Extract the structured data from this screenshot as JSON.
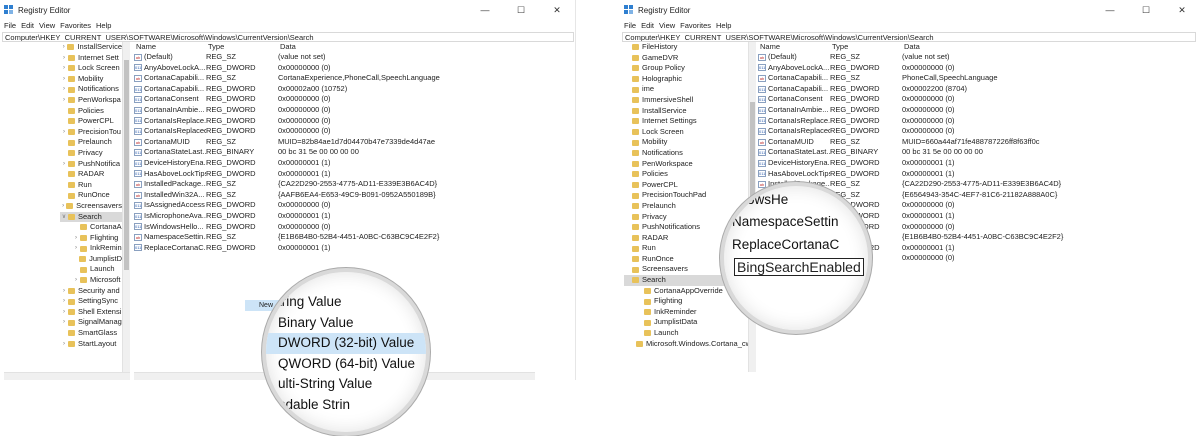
{
  "left": {
    "window_title": "Registry Editor",
    "menu": [
      "File",
      "Edit",
      "View",
      "Favorites",
      "Help"
    ],
    "address": "Computer\\HKEY_CURRENT_USER\\SOFTWARE\\Microsoft\\Windows\\CurrentVersion\\Search",
    "tree": [
      {
        "label": "InstallService",
        "chev": ">",
        "indent": 0
      },
      {
        "label": "Internet Sett",
        "chev": ">",
        "indent": 0
      },
      {
        "label": "Lock Screen",
        "chev": ">",
        "indent": 0
      },
      {
        "label": "Mobility",
        "chev": ">",
        "indent": 0
      },
      {
        "label": "Notifications",
        "chev": ">",
        "indent": 0
      },
      {
        "label": "PenWorkspa",
        "chev": ">",
        "indent": 0
      },
      {
        "label": "Policies",
        "chev": "",
        "indent": 0
      },
      {
        "label": "PowerCPL",
        "chev": "",
        "indent": 0
      },
      {
        "label": "PrecisionTou",
        "chev": ">",
        "indent": 0
      },
      {
        "label": "Prelaunch",
        "chev": "",
        "indent": 0
      },
      {
        "label": "Privacy",
        "chev": "",
        "indent": 0
      },
      {
        "label": "PushNotifica",
        "chev": ">",
        "indent": 0
      },
      {
        "label": "RADAR",
        "chev": "",
        "indent": 0
      },
      {
        "label": "Run",
        "chev": "",
        "indent": 0
      },
      {
        "label": "RunOnce",
        "chev": "",
        "indent": 0
      },
      {
        "label": "Screensavers",
        "chev": ">",
        "indent": 0
      },
      {
        "label": "Search",
        "chev": "v",
        "indent": 0,
        "selected": true
      },
      {
        "label": "CortanaA",
        "chev": "",
        "indent": 1
      },
      {
        "label": "Flighting",
        "chev": ">",
        "indent": 1
      },
      {
        "label": "InkRemin",
        "chev": ">",
        "indent": 1
      },
      {
        "label": "JumplistD",
        "chev": "",
        "indent": 1
      },
      {
        "label": "Launch",
        "chev": "",
        "indent": 1
      },
      {
        "label": "Microsoft",
        "chev": ">",
        "indent": 1
      },
      {
        "label": "Security and",
        "chev": ">",
        "indent": 0
      },
      {
        "label": "SettingSync",
        "chev": ">",
        "indent": 0
      },
      {
        "label": "Shell Extensi",
        "chev": ">",
        "indent": 0
      },
      {
        "label": "SignalManag",
        "chev": ">",
        "indent": 0
      },
      {
        "label": "SmartGlass",
        "chev": "",
        "indent": 0
      },
      {
        "label": "StartLayout",
        "chev": ">",
        "indent": 0
      }
    ],
    "headers": {
      "name": "Name",
      "type": "Type",
      "data": "Data"
    },
    "values": [
      {
        "icon": "ab",
        "name": "(Default)",
        "type": "REG_SZ",
        "data": "(value not set)"
      },
      {
        "icon": "011",
        "name": "AnyAboveLockA...",
        "type": "REG_DWORD",
        "data": "0x00000000 (0)"
      },
      {
        "icon": "ab",
        "name": "CortanaCapabili...",
        "type": "REG_SZ",
        "data": "CortanaExperience,PhoneCall,SpeechLanguage"
      },
      {
        "icon": "011",
        "name": "CortanaCapabili...",
        "type": "REG_DWORD",
        "data": "0x00002a00 (10752)"
      },
      {
        "icon": "011",
        "name": "CortanaConsent",
        "type": "REG_DWORD",
        "data": "0x00000000 (0)"
      },
      {
        "icon": "011",
        "name": "CortanaInAmbie...",
        "type": "REG_DWORD",
        "data": "0x00000000 (0)"
      },
      {
        "icon": "011",
        "name": "CortanaIsReplace...",
        "type": "REG_DWORD",
        "data": "0x00000000 (0)"
      },
      {
        "icon": "011",
        "name": "CortanaIsReplaced",
        "type": "REG_DWORD",
        "data": "0x00000000 (0)"
      },
      {
        "icon": "ab",
        "name": "CortanaMUID",
        "type": "REG_SZ",
        "data": "MUID=82b84ae1d7d04470b47e7339de4d47ae"
      },
      {
        "icon": "011",
        "name": "CortanaStateLast...",
        "type": "REG_BINARY",
        "data": "00 bc 31 5e 00 00 00 00"
      },
      {
        "icon": "011",
        "name": "DeviceHistoryEna...",
        "type": "REG_DWORD",
        "data": "0x00000001 (1)"
      },
      {
        "icon": "011",
        "name": "HasAboveLockTips",
        "type": "REG_DWORD",
        "data": "0x00000001 (1)"
      },
      {
        "icon": "ab",
        "name": "InstalledPackage...",
        "type": "REG_SZ",
        "data": "{CA22D290-2553-4775-AD11-E339E3B6AC4D}"
      },
      {
        "icon": "ab",
        "name": "InstalledWin32A...",
        "type": "REG_SZ",
        "data": "{AAFB6EA4-E653-49C9-B091-0952A550189B}"
      },
      {
        "icon": "011",
        "name": "IsAssignedAccess",
        "type": "REG_DWORD",
        "data": "0x00000000 (0)"
      },
      {
        "icon": "011",
        "name": "IsMicrophoneAva...",
        "type": "REG_DWORD",
        "data": "0x00000001 (1)"
      },
      {
        "icon": "011",
        "name": "IsWindowsHello...",
        "type": "REG_DWORD",
        "data": "0x00000000 (0)"
      },
      {
        "icon": "ab",
        "name": "NamespaceSettin...",
        "type": "REG_SZ",
        "data": "{E1B6B4B0-52B4-4451-A0BC-C63BC9C4E2F2}"
      },
      {
        "icon": "011",
        "name": "ReplaceCortanaC...",
        "type": "REG_DWORD",
        "data": "0x00000001 (1)"
      }
    ],
    "context_menu_new": "New",
    "magnifier_items": [
      "tring Value",
      "Binary Value",
      "DWORD (32-bit) Value",
      "QWORD (64-bit) Value",
      "ulti-String Value",
      "ndable Strin"
    ]
  },
  "right": {
    "window_title": "Registry Editor",
    "menu": [
      "File",
      "Edit",
      "View",
      "Favorites",
      "Help"
    ],
    "address": "Computer\\HKEY_CURRENT_USER\\SOFTWARE\\Microsoft\\Windows\\CurrentVersion\\Search",
    "tree": [
      {
        "label": "FileHistory",
        "indent": 0
      },
      {
        "label": "GameDVR",
        "indent": 0
      },
      {
        "label": "Group Policy",
        "indent": 0
      },
      {
        "label": "Holographic",
        "indent": 0
      },
      {
        "label": "ime",
        "indent": 0
      },
      {
        "label": "ImmersiveShell",
        "indent": 0
      },
      {
        "label": "InstallService",
        "indent": 0
      },
      {
        "label": "Internet Settings",
        "indent": 0
      },
      {
        "label": "Lock Screen",
        "indent": 0
      },
      {
        "label": "Mobility",
        "indent": 0
      },
      {
        "label": "Notifications",
        "indent": 0
      },
      {
        "label": "PenWorkspace",
        "indent": 0
      },
      {
        "label": "Policies",
        "indent": 0
      },
      {
        "label": "PowerCPL",
        "indent": 0
      },
      {
        "label": "PrecisionTouchPad",
        "indent": 0
      },
      {
        "label": "Prelaunch",
        "indent": 0
      },
      {
        "label": "Privacy",
        "indent": 0
      },
      {
        "label": "PushNotifications",
        "indent": 0
      },
      {
        "label": "RADAR",
        "indent": 0
      },
      {
        "label": "Run",
        "indent": 0
      },
      {
        "label": "RunOnce",
        "indent": 0
      },
      {
        "label": "Screensavers",
        "indent": 0
      },
      {
        "label": "Search",
        "indent": 0,
        "selected": true
      },
      {
        "label": "CortanaAppOverride",
        "indent": 1
      },
      {
        "label": "Flighting",
        "indent": 1
      },
      {
        "label": "InkReminder",
        "indent": 1
      },
      {
        "label": "JumplistData",
        "indent": 1
      },
      {
        "label": "Launch",
        "indent": 1
      },
      {
        "label": "Microsoft.Windows.Cortana_cw5n",
        "indent": 1
      }
    ],
    "headers": {
      "name": "Name",
      "type": "Type",
      "data": "Data"
    },
    "values": [
      {
        "icon": "ab",
        "name": "(Default)",
        "type": "REG_SZ",
        "data": "(value not set)"
      },
      {
        "icon": "011",
        "name": "AnyAboveLockA...",
        "type": "REG_DWORD",
        "data": "0x00000000 (0)"
      },
      {
        "icon": "ab",
        "name": "CortanaCapabili...",
        "type": "REG_SZ",
        "data": "PhoneCall,SpeechLanguage"
      },
      {
        "icon": "011",
        "name": "CortanaCapabili...",
        "type": "REG_DWORD",
        "data": "0x00002200 (8704)"
      },
      {
        "icon": "011",
        "name": "CortanaConsent",
        "type": "REG_DWORD",
        "data": "0x00000000 (0)"
      },
      {
        "icon": "011",
        "name": "CortanaInAmbie...",
        "type": "REG_DWORD",
        "data": "0x00000000 (0)"
      },
      {
        "icon": "011",
        "name": "CortanaIsReplace...",
        "type": "REG_DWORD",
        "data": "0x00000000 (0)"
      },
      {
        "icon": "011",
        "name": "CortanaIsReplaced",
        "type": "REG_DWORD",
        "data": "0x00000000 (0)"
      },
      {
        "icon": "ab",
        "name": "CortanaMUID",
        "type": "REG_SZ",
        "data": "MUID=660a44af71fe488787226ff8f63ff0c"
      },
      {
        "icon": "011",
        "name": "CortanaStateLast...",
        "type": "REG_BINARY",
        "data": "00 bc 31 5e 00 00 00 00"
      },
      {
        "icon": "011",
        "name": "DeviceHistoryEna...",
        "type": "REG_DWORD",
        "data": "0x00000001 (1)"
      },
      {
        "icon": "011",
        "name": "HasAboveLockTips",
        "type": "REG_DWORD",
        "data": "0x00000001 (1)"
      },
      {
        "icon": "ab",
        "name": "InstalledPackage...",
        "type": "REG_SZ",
        "data": "{CA22D290-2553-4775-AD11-E339E3B6AC4D}"
      },
      {
        "icon": "ab",
        "name": "",
        "type": "REG_SZ",
        "data": "{E6564943-354C-4EF7-81C6-21182A888A0C}"
      },
      {
        "icon": "011",
        "name": "",
        "type": "REG_DWORD",
        "data": "0x00000000 (0)"
      },
      {
        "icon": "011",
        "name": "",
        "type": "REG_DWORD",
        "data": "0x00000001 (1)"
      },
      {
        "icon": "011",
        "name": "",
        "type": "REG_DWORD",
        "data": "0x00000000 (0)"
      },
      {
        "icon": "ab",
        "name": "",
        "type": "REG_SZ",
        "data": "{E1B6B4B0-52B4-4451-A0BC-C63BC9C4E2F2}"
      },
      {
        "icon": "011",
        "name": "",
        "type": "REG_DWORD",
        "data": "0x00000001 (1)"
      },
      {
        "icon": "011",
        "name": "",
        "type": "",
        "data": "0x00000000 (0)"
      }
    ],
    "magnifier_items": [
      "ndowsHe",
      "NamespaceSettin",
      "ReplaceCortanaC"
    ],
    "rename_value": "BingSearchEnabled"
  }
}
